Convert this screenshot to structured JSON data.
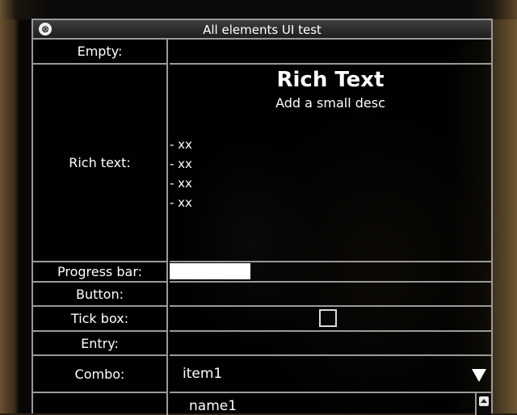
{
  "window": {
    "title": "All elements UI test",
    "close_glyph": "⊗"
  },
  "rows": {
    "empty_label": "Empty:",
    "rich_label": "Rich text:",
    "progress_label": "Progress bar:",
    "button_label": "Button:",
    "tick_label": "Tick box:",
    "entry_label": "Entry:",
    "combo_label": "Combo:"
  },
  "rich_text": {
    "heading": "Rich Text",
    "subheading": "Add a small desc",
    "items": [
      "- xx",
      "- xx",
      "- xx",
      "- xx"
    ]
  },
  "progress": {
    "fraction": 0.25
  },
  "button": {
    "label": ""
  },
  "tickbox": {
    "checked": false
  },
  "entry": {
    "value": "",
    "placeholder": ""
  },
  "combo": {
    "selected": "item1"
  },
  "list": {
    "items": [
      "name1"
    ]
  },
  "colors": {
    "border": "#9a9a9a",
    "panel": "#000000",
    "text": "#ffffff"
  },
  "icons": {
    "close": "close-icon",
    "combo": "dropdown-arrow-icon",
    "scroll": "scroll-up-icon"
  }
}
